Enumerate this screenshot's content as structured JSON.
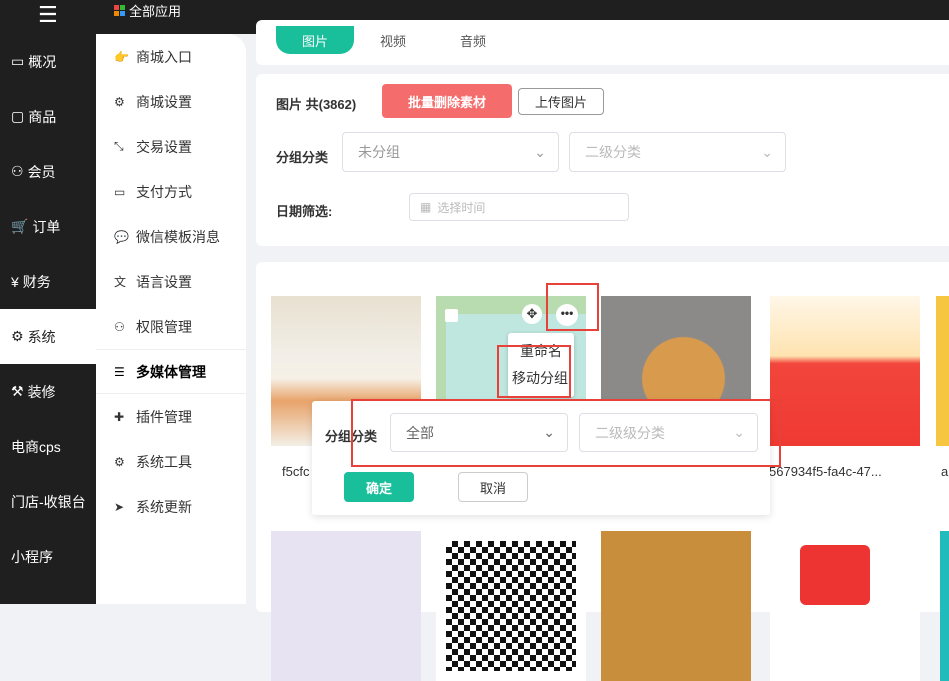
{
  "header": {
    "all_apps": "全部应用"
  },
  "sidebar": {
    "items": [
      {
        "label": "概况",
        "icon": "chart-icon"
      },
      {
        "label": "商品",
        "icon": "shop-icon"
      },
      {
        "label": "会员",
        "icon": "users-icon"
      },
      {
        "label": "订单",
        "icon": "cart-icon"
      },
      {
        "label": "财务",
        "icon": "finance-icon"
      },
      {
        "label": "系统",
        "icon": "gear-icon"
      },
      {
        "label": "装修",
        "icon": "brush-icon"
      },
      {
        "label": "电商cps"
      },
      {
        "label": "门店-收银台"
      },
      {
        "label": "小程序"
      }
    ]
  },
  "submenu": {
    "items": [
      {
        "label": "商城入口",
        "icon": "👉"
      },
      {
        "label": "商城设置",
        "icon": "⚙"
      },
      {
        "label": "交易设置",
        "icon": "⤡"
      },
      {
        "label": "支付方式",
        "icon": "▭"
      },
      {
        "label": "微信模板消息",
        "icon": "💬"
      },
      {
        "label": "语言设置",
        "icon": "文"
      },
      {
        "label": "权限管理",
        "icon": "⚇"
      },
      {
        "label": "多媒体管理",
        "icon": "☰"
      },
      {
        "label": "插件管理",
        "icon": "✚"
      },
      {
        "label": "系统工具",
        "icon": "⚙"
      },
      {
        "label": "系统更新",
        "icon": "➤"
      }
    ]
  },
  "tabs": [
    "图片",
    "视频",
    "音频"
  ],
  "toolbar": {
    "title": "图片 共(3862)",
    "batch_delete": "批量删除素材",
    "upload": "上传图片"
  },
  "filters": {
    "group_label": "分组分类",
    "group_value": "未分组",
    "sub_placeholder": "二级分类",
    "date_label": "日期筛选:",
    "date_placeholder": "选择时间"
  },
  "images": [
    {
      "name": "f5cfc"
    },
    {
      "name": ""
    },
    {
      "name": ""
    },
    {
      "name": "567934f5-fa4c-47..."
    },
    {
      "name": "a"
    }
  ],
  "context_menu": {
    "rename": "重命名",
    "move": "移动分组"
  },
  "move_dialog": {
    "label": "分组分类",
    "group_value": "全部",
    "sub_placeholder": "二级级分类",
    "confirm": "确定",
    "cancel": "取消"
  },
  "colors": {
    "accent": "#19be9b",
    "danger": "#f56c6c",
    "highlight": "#e8413a"
  }
}
